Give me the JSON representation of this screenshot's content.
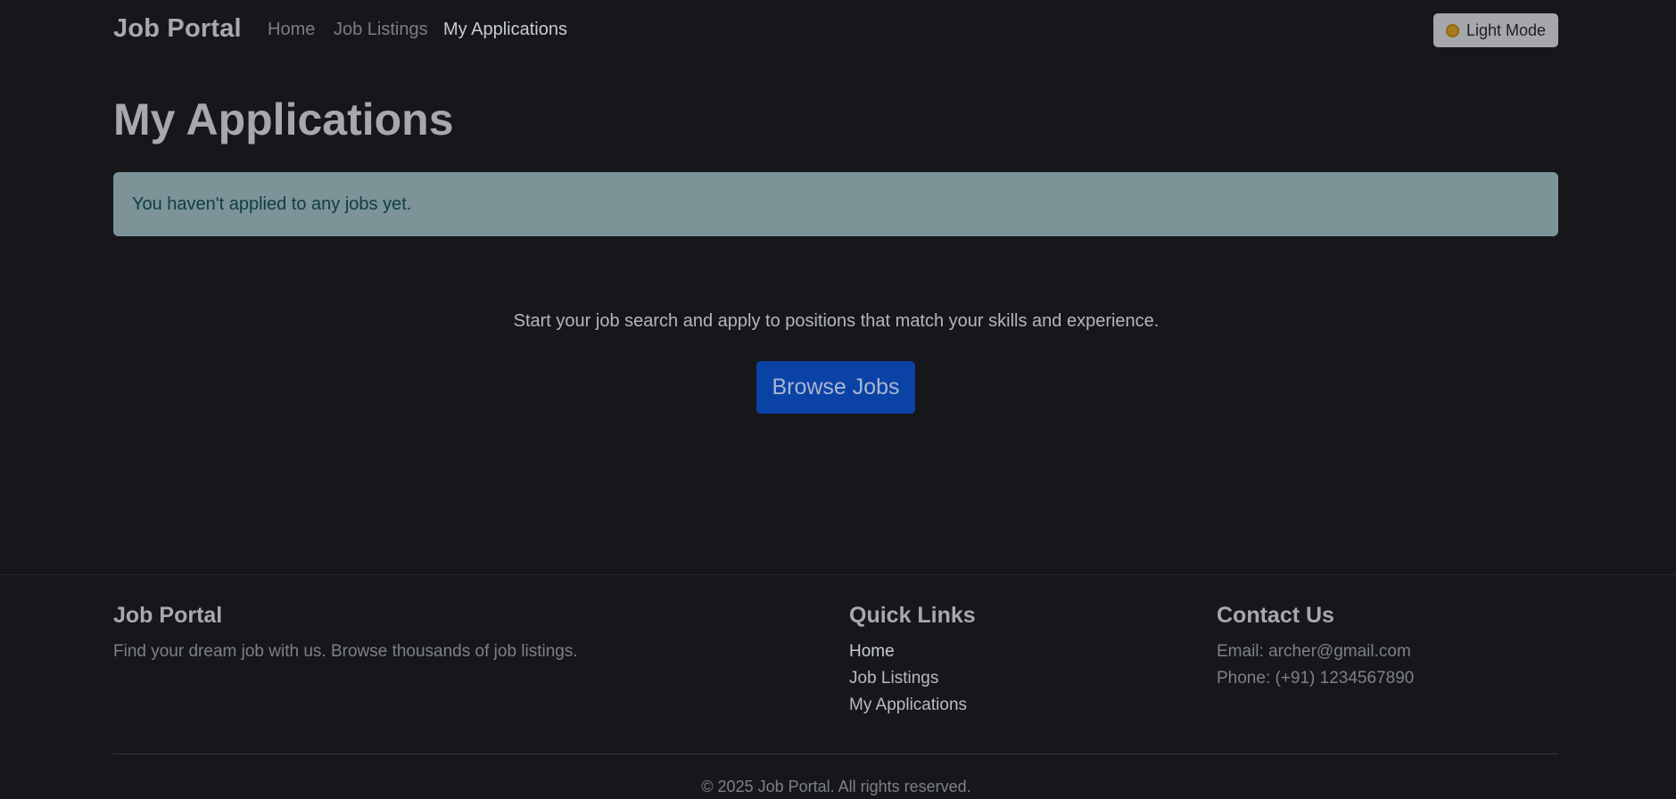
{
  "navbar": {
    "brand": "Job Portal",
    "links": [
      {
        "label": "Home",
        "active": false
      },
      {
        "label": "Job Listings",
        "active": false
      },
      {
        "label": "My Applications",
        "active": true
      }
    ],
    "theme_toggle": {
      "label": "Light Mode",
      "icon": "sun-icon"
    }
  },
  "main": {
    "title": "My Applications",
    "alert": "You haven't applied to any jobs yet.",
    "empty_text": "Start your job search and apply to positions that match your skills and experience.",
    "browse_button": "Browse Jobs"
  },
  "footer": {
    "about": {
      "heading": "Job Portal",
      "text": "Find your dream job with us. Browse thousands of job listings."
    },
    "quick_links": {
      "heading": "Quick Links",
      "items": [
        "Home",
        "Job Listings",
        "My Applications"
      ]
    },
    "contact": {
      "heading": "Contact Us",
      "email": "Email: archer@gmail.com",
      "phone": "Phone: (+91) 1234567890"
    },
    "copyright": "© 2025 Job Portal. All rights reserved."
  },
  "colors": {
    "background": "#16171b",
    "alert_background": "#7c9397",
    "primary_button": "#0b42a6"
  }
}
